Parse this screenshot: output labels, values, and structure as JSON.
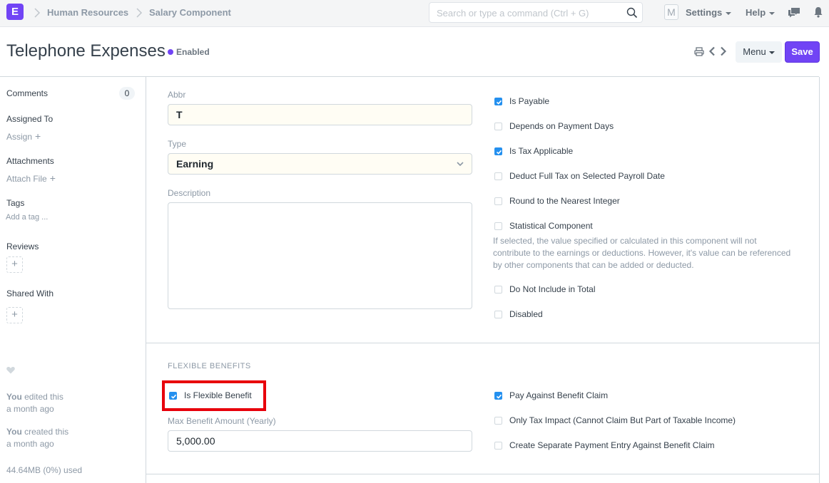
{
  "navbar": {
    "logo_letter": "E",
    "breadcrumbs": [
      "Human Resources",
      "Salary Component"
    ],
    "search_placeholder": "Search or type a command (Ctrl + G)",
    "avatar_letter": "M",
    "settings_label": "Settings",
    "help_label": "Help"
  },
  "header": {
    "title": "Telephone Expenses",
    "status": "Enabled",
    "status_color": "#7144f5",
    "menu_label": "Menu",
    "save_label": "Save"
  },
  "sidebar": {
    "comments_label": "Comments",
    "comments_count": "0",
    "assigned_to_label": "Assigned To",
    "assign_label": "Assign",
    "attachments_label": "Attachments",
    "attach_file_label": "Attach File",
    "tags_label": "Tags",
    "add_tag_label": "Add a tag ...",
    "reviews_label": "Reviews",
    "shared_with_label": "Shared With",
    "activity": [
      {
        "who": "You",
        "action": " edited this",
        "when": "a month ago"
      },
      {
        "who": "You",
        "action": " created this",
        "when": "a month ago"
      }
    ],
    "storage_used": "44.64MB (0%) used"
  },
  "form": {
    "abbr_label": "Abbr",
    "abbr_value": "T",
    "type_label": "Type",
    "type_value": "Earning",
    "description_label": "Description",
    "description_value": "",
    "checkboxes": [
      {
        "label": "Is Payable",
        "checked": true
      },
      {
        "label": "Depends on Payment Days",
        "checked": false
      },
      {
        "label": "Is Tax Applicable",
        "checked": true
      },
      {
        "label": "Deduct Full Tax on Selected Payroll Date",
        "checked": false
      },
      {
        "label": "Round to the Nearest Integer",
        "checked": false
      },
      {
        "label": "Statistical Component",
        "checked": false
      },
      {
        "label": "Do Not Include in Total",
        "checked": false
      },
      {
        "label": "Disabled",
        "checked": false
      }
    ],
    "statistical_help": "If selected, the value specified or calculated in this component will not contribute to the earnings or deductions. However, it's value can be referenced by other components that can be added or deducted."
  },
  "flexible_benefits": {
    "section_title": "FLEXIBLE BENEFITS",
    "is_flexible_benefit": {
      "label": "Is Flexible Benefit",
      "checked": true
    },
    "max_benefit_label": "Max Benefit Amount (Yearly)",
    "max_benefit_value": "5,000.00",
    "checkboxes": [
      {
        "label": "Pay Against Benefit Claim",
        "checked": true
      },
      {
        "label": "Only Tax Impact (Cannot Claim But Part of Taxable Income)",
        "checked": false
      },
      {
        "label": "Create Separate Payment Entry Against Benefit Claim",
        "checked": false
      }
    ]
  },
  "colors": {
    "accent": "#7144f5",
    "checkbox_checked": "#2490ef",
    "highlight": "#e8000b"
  }
}
